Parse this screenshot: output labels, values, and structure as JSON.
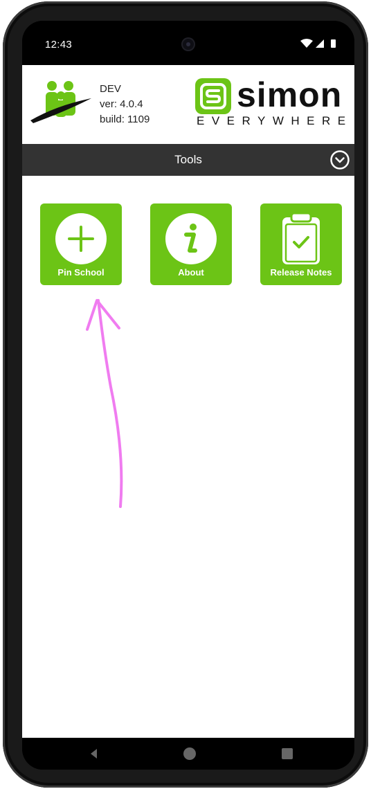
{
  "status_bar": {
    "time": "12:43"
  },
  "header": {
    "env": "DEV",
    "version": "ver: 4.0.4",
    "build": "build: 1109",
    "brand_word": "simon",
    "brand_tagline": "EVERYWHERE"
  },
  "toolbar": {
    "title": "Tools",
    "toggle_icon": "chevron-down-circle-icon"
  },
  "tools": [
    {
      "label": "Pin School",
      "icon": "plus-icon"
    },
    {
      "label": "About",
      "icon": "info-icon"
    },
    {
      "label": "Release Notes",
      "icon": "clipboard-check-icon"
    }
  ],
  "annotation": {
    "color": "#f07cf0"
  },
  "colors": {
    "accent": "#6cc416",
    "toolbar": "#333333"
  }
}
